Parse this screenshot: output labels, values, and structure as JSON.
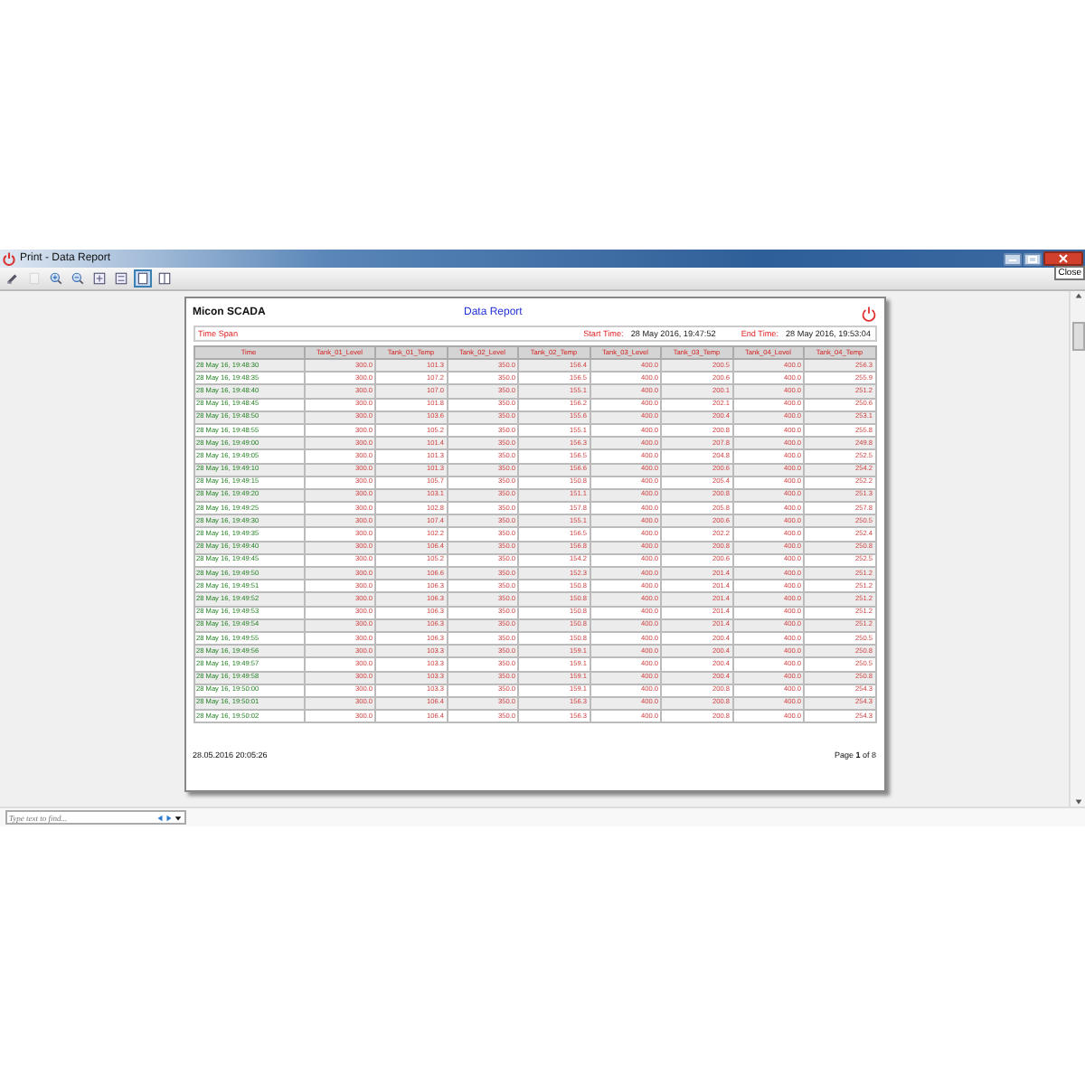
{
  "window": {
    "title": "Print - Data Report",
    "tooltip": "Close"
  },
  "toolbar": [
    {
      "kind": "print",
      "selected": false,
      "disabled": false
    },
    {
      "kind": "page",
      "selected": false,
      "disabled": true
    },
    {
      "kind": "zoom-in",
      "selected": false,
      "disabled": false
    },
    {
      "kind": "zoom-out",
      "selected": false,
      "disabled": false
    },
    {
      "kind": "fit-page",
      "selected": false,
      "disabled": false
    },
    {
      "kind": "fit-width",
      "selected": false,
      "disabled": false
    },
    {
      "kind": "single-page",
      "selected": true,
      "disabled": false
    },
    {
      "kind": "two-pages",
      "selected": false,
      "disabled": false
    }
  ],
  "report": {
    "company": "Micon SCADA",
    "title": "Data Report",
    "time_span_label": "Time Span",
    "start_label": "Start Time:",
    "start_value": "28 May 2016, 19:47:52",
    "end_label": "End Time:",
    "end_value": "28 May 2016, 19:53:04",
    "columns": [
      "Time",
      "Tank_01_Level",
      "Tank_01_Temp",
      "Tank_02_Level",
      "Tank_02_Temp",
      "Tank_03_Level",
      "Tank_03_Temp",
      "Tank_04_Level",
      "Tank_04_Temp"
    ],
    "rows": [
      [
        "28 May 16, 19:48:30",
        "300.0",
        "101.3",
        "350.0",
        "156.4",
        "400.0",
        "200.5",
        "400.0",
        "256.3"
      ],
      [
        "28 May 16, 19:48:35",
        "300.0",
        "107.2",
        "350.0",
        "156.5",
        "400.0",
        "200.6",
        "400.0",
        "255.9"
      ],
      [
        "28 May 16, 19:48:40",
        "300.0",
        "107.0",
        "350.0",
        "155.1",
        "400.0",
        "200.1",
        "400.0",
        "251.2"
      ],
      [
        "28 May 16, 19:48:45",
        "300.0",
        "101.8",
        "350.0",
        "156.2",
        "400.0",
        "202.1",
        "400.0",
        "250.6"
      ],
      [
        "28 May 16, 19:48:50",
        "300.0",
        "103.6",
        "350.0",
        "155.6",
        "400.0",
        "200.4",
        "400.0",
        "253.1"
      ],
      [
        "28 May 16, 19:48:55",
        "300.0",
        "105.2",
        "350.0",
        "155.1",
        "400.0",
        "200.8",
        "400.0",
        "255.8"
      ],
      [
        "28 May 16, 19:49:00",
        "300.0",
        "101.4",
        "350.0",
        "156.3",
        "400.0",
        "207.8",
        "400.0",
        "249.8"
      ],
      [
        "28 May 16, 19:49:05",
        "300.0",
        "101.3",
        "350.0",
        "156.5",
        "400.0",
        "204.8",
        "400.0",
        "252.5"
      ],
      [
        "28 May 16, 19:49:10",
        "300.0",
        "101.3",
        "350.0",
        "156.6",
        "400.0",
        "200.6",
        "400.0",
        "254.2"
      ],
      [
        "28 May 16, 19:49:15",
        "300.0",
        "105.7",
        "350.0",
        "150.8",
        "400.0",
        "205.4",
        "400.0",
        "252.2"
      ],
      [
        "28 May 16, 19:49:20",
        "300.0",
        "103.1",
        "350.0",
        "151.1",
        "400.0",
        "200.8",
        "400.0",
        "251.3"
      ],
      [
        "28 May 16, 19:49:25",
        "300.0",
        "102.8",
        "350.0",
        "157.8",
        "400.0",
        "205.8",
        "400.0",
        "257.8"
      ],
      [
        "28 May 16, 19:49:30",
        "300.0",
        "107.4",
        "350.0",
        "155.1",
        "400.0",
        "200.6",
        "400.0",
        "250.5"
      ],
      [
        "28 May 16, 19:49:35",
        "300.0",
        "102.2",
        "350.0",
        "156.5",
        "400.0",
        "202.2",
        "400.0",
        "252.4"
      ],
      [
        "28 May 16, 19:49:40",
        "300.0",
        "106.4",
        "350.0",
        "156.8",
        "400.0",
        "200.8",
        "400.0",
        "250.8"
      ],
      [
        "28 May 16, 19:49:45",
        "300.0",
        "105.2",
        "350.0",
        "154.2",
        "400.0",
        "200.6",
        "400.0",
        "252.5"
      ],
      [
        "28 May 16, 19:49:50",
        "300.0",
        "106.6",
        "350.0",
        "152.3",
        "400.0",
        "201.4",
        "400.0",
        "251.2"
      ],
      [
        "28 May 16, 19:49:51",
        "300.0",
        "106.3",
        "350.0",
        "150.8",
        "400.0",
        "201.4",
        "400.0",
        "251.2"
      ],
      [
        "28 May 16, 19:49:52",
        "300.0",
        "106.3",
        "350.0",
        "150.8",
        "400.0",
        "201.4",
        "400.0",
        "251.2"
      ],
      [
        "28 May 16, 19:49:53",
        "300.0",
        "106.3",
        "350.0",
        "150.8",
        "400.0",
        "201.4",
        "400.0",
        "251.2"
      ],
      [
        "28 May 16, 19:49:54",
        "300.0",
        "106.3",
        "350.0",
        "150.8",
        "400.0",
        "201.4",
        "400.0",
        "251.2"
      ],
      [
        "28 May 16, 19:49:55",
        "300.0",
        "106.3",
        "350.0",
        "150.8",
        "400.0",
        "200.4",
        "400.0",
        "250.5"
      ],
      [
        "28 May 16, 19:49:56",
        "300.0",
        "103.3",
        "350.0",
        "159.1",
        "400.0",
        "200.4",
        "400.0",
        "250.8"
      ],
      [
        "28 May 16, 19:49:57",
        "300.0",
        "103.3",
        "350.0",
        "159.1",
        "400.0",
        "200.4",
        "400.0",
        "250.5"
      ],
      [
        "28 May 16, 19:49:58",
        "300.0",
        "103.3",
        "350.0",
        "159.1",
        "400.0",
        "200.4",
        "400.0",
        "250.8"
      ],
      [
        "28 May 16, 19:50:00",
        "300.0",
        "103.3",
        "350.0",
        "159.1",
        "400.0",
        "200.8",
        "400.0",
        "254.3"
      ],
      [
        "28 May 16, 19:50:01",
        "300.0",
        "106.4",
        "350.0",
        "156.3",
        "400.0",
        "200.8",
        "400.0",
        "254.3"
      ],
      [
        "28 May 16, 19:50:02",
        "300.0",
        "106.4",
        "350.0",
        "156.3",
        "400.0",
        "200.8",
        "400.0",
        "254.3"
      ]
    ],
    "printed_at": "28.05.2016 20:05:26",
    "page": "Page **1** of 8"
  },
  "find": {
    "placeholder": "Type text to find..."
  }
}
